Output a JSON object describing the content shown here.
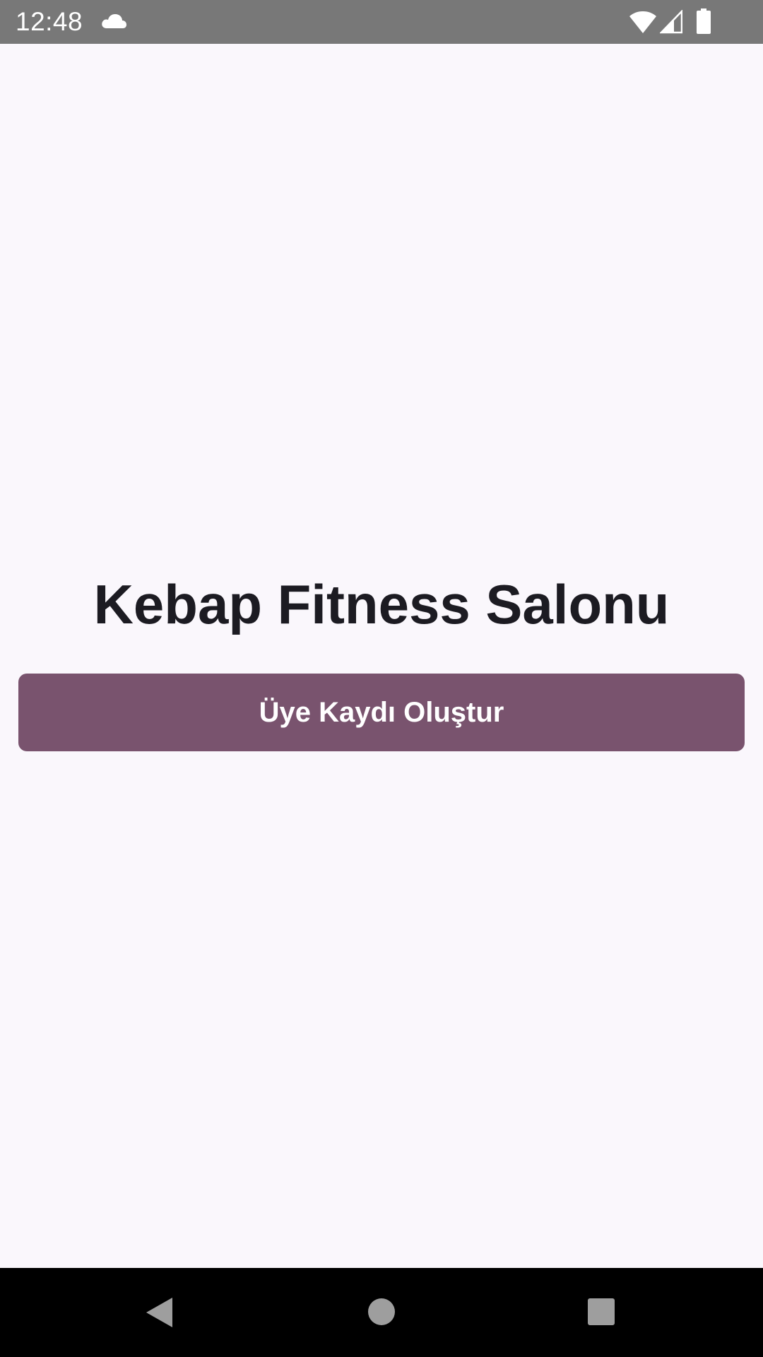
{
  "status_bar": {
    "time": "12:48",
    "icons": [
      "cloud-icon",
      "wifi-icon",
      "cell-signal-icon",
      "battery-icon"
    ]
  },
  "main": {
    "title": "Kebap Fitness Salonu",
    "create_member_button_label": "Üye Kaydı Oluştur"
  },
  "nav_bar": {
    "icons": [
      "back-icon",
      "home-icon",
      "recents-icon"
    ]
  },
  "colors": {
    "background": "#faf7fc",
    "status_bar": "#787878",
    "primary": "#79536e",
    "title_text": "#1c1b22",
    "nav_bar": "#000000"
  }
}
